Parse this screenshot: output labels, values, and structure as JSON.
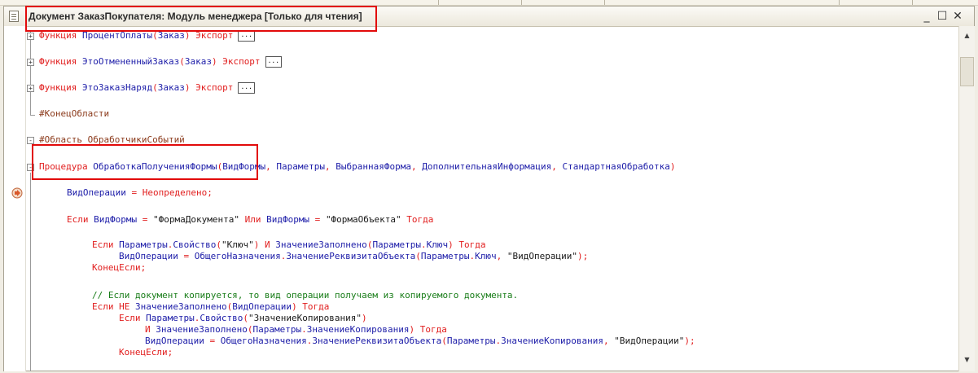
{
  "window": {
    "title": "Документ ЗаказПокупателя: Модуль менеджера [Только для чтения]",
    "buttons": {
      "minimize": "_",
      "maximize": "☐",
      "close": "✕"
    }
  },
  "code": [
    {
      "fold": "+",
      "collapsed": true,
      "tokens": [
        {
          "t": "kw",
          "v": "Функция "
        },
        {
          "t": "id",
          "v": "ПроцентОплаты"
        },
        {
          "t": "kw",
          "v": "("
        },
        {
          "t": "id",
          "v": "Заказ"
        },
        {
          "t": "kw",
          "v": ") Экспорт"
        }
      ]
    },
    {
      "fold": "+",
      "collapsed": true,
      "tokens": [
        {
          "t": "kw",
          "v": "Функция "
        },
        {
          "t": "id",
          "v": "ЭтоОтмененныйЗаказ"
        },
        {
          "t": "kw",
          "v": "("
        },
        {
          "t": "id",
          "v": "Заказ"
        },
        {
          "t": "kw",
          "v": ") Экспорт"
        }
      ]
    },
    {
      "fold": "+",
      "collapsed": true,
      "tokens": [
        {
          "t": "kw",
          "v": "Функция "
        },
        {
          "t": "id",
          "v": "ЭтоЗаказНаряд"
        },
        {
          "t": "kw",
          "v": "("
        },
        {
          "t": "id",
          "v": "Заказ"
        },
        {
          "t": "kw",
          "v": ") Экспорт"
        }
      ]
    },
    {
      "fold": "",
      "tokens": [
        {
          "t": "pre",
          "v": "#КонецОбласти"
        }
      ]
    },
    {
      "fold": "-",
      "tokens": [
        {
          "t": "pre",
          "v": "#Область ОбработчикиСобытий"
        }
      ]
    },
    {
      "fold": "-",
      "tokens": [
        {
          "t": "kw",
          "v": "Процедура "
        },
        {
          "t": "id",
          "v": "ОбработкаПолученияФормы"
        },
        {
          "t": "kw",
          "v": "("
        },
        {
          "t": "id",
          "v": "ВидФормы"
        },
        {
          "t": "kw",
          "v": ", "
        },
        {
          "t": "id",
          "v": "Параметры"
        },
        {
          "t": "kw",
          "v": ", "
        },
        {
          "t": "id",
          "v": "ВыбраннаяФорма"
        },
        {
          "t": "kw",
          "v": ", "
        },
        {
          "t": "id",
          "v": "ДополнительнаяИнформация"
        },
        {
          "t": "kw",
          "v": ", "
        },
        {
          "t": "id",
          "v": "СтандартнаяОбработка"
        },
        {
          "t": "kw",
          "v": ")"
        }
      ]
    },
    {
      "fold": "",
      "tokens": [
        {
          "t": "id",
          "v": "ВидОперации"
        },
        {
          "t": "kw",
          "v": " = Неопределено;"
        }
      ]
    },
    {
      "fold": "",
      "tokens": [
        {
          "t": "kw",
          "v": "Если "
        },
        {
          "t": "id",
          "v": "ВидФормы"
        },
        {
          "t": "kw",
          "v": " = "
        },
        {
          "t": "str",
          "v": "\"ФормаДокумента\""
        },
        {
          "t": "kw",
          "v": " Или "
        },
        {
          "t": "id",
          "v": "ВидФормы"
        },
        {
          "t": "kw",
          "v": " = "
        },
        {
          "t": "str",
          "v": "\"ФормаОбъекта\""
        },
        {
          "t": "kw",
          "v": " Тогда"
        }
      ]
    },
    {
      "fold": "",
      "tokens": [
        {
          "t": "kw",
          "v": "Если "
        },
        {
          "t": "id",
          "v": "Параметры"
        },
        {
          "t": "kw",
          "v": "."
        },
        {
          "t": "id",
          "v": "Свойство"
        },
        {
          "t": "kw",
          "v": "("
        },
        {
          "t": "str",
          "v": "\"Ключ\""
        },
        {
          "t": "kw",
          "v": ") И "
        },
        {
          "t": "id",
          "v": "ЗначениеЗаполнено"
        },
        {
          "t": "kw",
          "v": "("
        },
        {
          "t": "id",
          "v": "Параметры"
        },
        {
          "t": "kw",
          "v": "."
        },
        {
          "t": "id",
          "v": "Ключ"
        },
        {
          "t": "kw",
          "v": ") Тогда"
        }
      ]
    },
    {
      "fold": "",
      "tokens": [
        {
          "t": "id",
          "v": "ВидОперации"
        },
        {
          "t": "kw",
          "v": " = "
        },
        {
          "t": "id",
          "v": "ОбщегоНазначения"
        },
        {
          "t": "kw",
          "v": "."
        },
        {
          "t": "id",
          "v": "ЗначениеРеквизитаОбъекта"
        },
        {
          "t": "kw",
          "v": "("
        },
        {
          "t": "id",
          "v": "Параметры"
        },
        {
          "t": "kw",
          "v": "."
        },
        {
          "t": "id",
          "v": "Ключ"
        },
        {
          "t": "kw",
          "v": ", "
        },
        {
          "t": "str",
          "v": "\"ВидОперации\""
        },
        {
          "t": "kw",
          "v": ");"
        }
      ]
    },
    {
      "fold": "",
      "tokens": [
        {
          "t": "kw",
          "v": "КонецЕсли;"
        }
      ]
    },
    {
      "fold": "",
      "tokens": [
        {
          "t": "cmt",
          "v": "// Если документ копируется, то вид операции получаем из копируемого документа."
        }
      ]
    },
    {
      "fold": "",
      "tokens": [
        {
          "t": "kw",
          "v": "Если НЕ "
        },
        {
          "t": "id",
          "v": "ЗначениеЗаполнено"
        },
        {
          "t": "kw",
          "v": "("
        },
        {
          "t": "id",
          "v": "ВидОперации"
        },
        {
          "t": "kw",
          "v": ") Тогда"
        }
      ]
    },
    {
      "fold": "",
      "tokens": [
        {
          "t": "kw",
          "v": "Если "
        },
        {
          "t": "id",
          "v": "Параметры"
        },
        {
          "t": "kw",
          "v": "."
        },
        {
          "t": "id",
          "v": "Свойство"
        },
        {
          "t": "kw",
          "v": "("
        },
        {
          "t": "str",
          "v": "\"ЗначениеКопирования\""
        },
        {
          "t": "kw",
          "v": ")"
        }
      ]
    },
    {
      "fold": "",
      "tokens": [
        {
          "t": "kw",
          "v": "И "
        },
        {
          "t": "id",
          "v": "ЗначениеЗаполнено"
        },
        {
          "t": "kw",
          "v": "("
        },
        {
          "t": "id",
          "v": "Параметры"
        },
        {
          "t": "kw",
          "v": "."
        },
        {
          "t": "id",
          "v": "ЗначениеКопирования"
        },
        {
          "t": "kw",
          "v": ") Тогда"
        }
      ]
    },
    {
      "fold": "",
      "tokens": [
        {
          "t": "id",
          "v": "ВидОперации"
        },
        {
          "t": "kw",
          "v": " = "
        },
        {
          "t": "id",
          "v": "ОбщегоНазначения"
        },
        {
          "t": "kw",
          "v": "."
        },
        {
          "t": "id",
          "v": "ЗначениеРеквизитаОбъекта"
        },
        {
          "t": "kw",
          "v": "("
        },
        {
          "t": "id",
          "v": "Параметры"
        },
        {
          "t": "kw",
          "v": "."
        },
        {
          "t": "id",
          "v": "ЗначениеКопирования"
        },
        {
          "t": "kw",
          "v": ", "
        },
        {
          "t": "str",
          "v": "\"ВидОперации\""
        },
        {
          "t": "kw",
          "v": ");"
        }
      ]
    },
    {
      "fold": "",
      "tokens": [
        {
          "t": "kw",
          "v": "КонецЕсли;"
        }
      ]
    }
  ],
  "colors": {
    "keyword": "#e11d1d",
    "identifier": "#1c1ca8",
    "string": "#1a1a1a",
    "comment": "#197d19",
    "preprocessor": "#8b3a1b",
    "highlight_box": "#e20b0b"
  },
  "icons": {
    "document": "document-icon",
    "breakpoint": "current-line-arrow-icon",
    "scroll_up": "scroll-up-icon",
    "scroll_down": "scroll-down-icon"
  }
}
